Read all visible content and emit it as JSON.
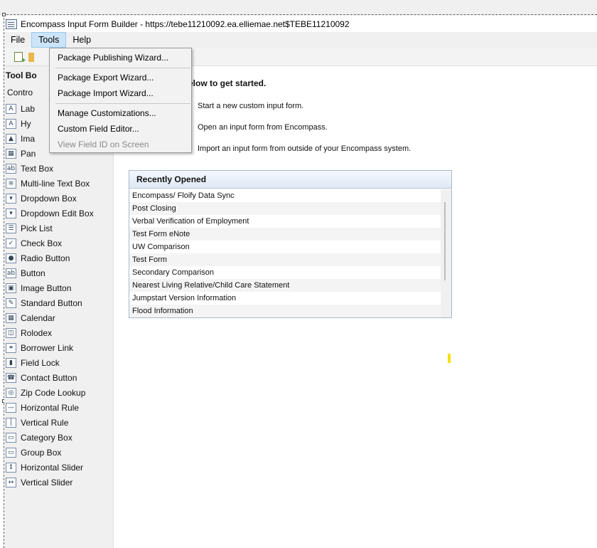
{
  "window": {
    "title": "Encompass Input Form Builder - https://tebe11210092.ea.elliemae.net$TEBE11210092"
  },
  "menubar": {
    "items": [
      "File",
      "Tools",
      "Help"
    ]
  },
  "tools_menu": {
    "items": [
      {
        "label": "Package Publishing Wizard...",
        "enabled": true
      },
      {
        "label": "Package Export Wizard...",
        "enabled": true
      },
      {
        "label": "Package Import Wizard...",
        "enabled": true
      },
      {
        "label": "Manage Customizations...",
        "enabled": true
      },
      {
        "label": "Custom Field Editor...",
        "enabled": true
      },
      {
        "label": "View Field ID on Screen",
        "enabled": false
      }
    ]
  },
  "toolbox": {
    "header": "Tool Bo",
    "controls_label": "Contro",
    "items": [
      {
        "label": "Lab",
        "icon": "label-icon"
      },
      {
        "label": "Hy",
        "icon": "hyperlink-icon"
      },
      {
        "label": "Ima",
        "icon": "image-icon"
      },
      {
        "label": "Pan",
        "icon": "panel-icon"
      },
      {
        "label": "Text Box",
        "icon": "textbox-icon"
      },
      {
        "label": "Multi-line Text Box",
        "icon": "multiline-textbox-icon"
      },
      {
        "label": "Dropdown Box",
        "icon": "dropdown-icon"
      },
      {
        "label": "Dropdown Edit Box",
        "icon": "dropdown-edit-icon"
      },
      {
        "label": "Pick List",
        "icon": "picklist-icon"
      },
      {
        "label": "Check Box",
        "icon": "checkbox-icon"
      },
      {
        "label": "Radio Button",
        "icon": "radio-icon"
      },
      {
        "label": "Button",
        "icon": "button-icon"
      },
      {
        "label": "Image Button",
        "icon": "image-button-icon"
      },
      {
        "label": "Standard Button",
        "icon": "standard-button-icon"
      },
      {
        "label": "Calendar",
        "icon": "calendar-icon"
      },
      {
        "label": "Rolodex",
        "icon": "rolodex-icon"
      },
      {
        "label": "Borrower Link",
        "icon": "borrower-link-icon"
      },
      {
        "label": "Field Lock",
        "icon": "lock-icon"
      },
      {
        "label": "Contact Button",
        "icon": "contact-icon"
      },
      {
        "label": "Zip Code Lookup",
        "icon": "zip-lookup-icon"
      },
      {
        "label": "Horizontal Rule",
        "icon": "horizontal-rule-icon"
      },
      {
        "label": "Vertical Rule",
        "icon": "vertical-rule-icon"
      },
      {
        "label": "Category Box",
        "icon": "category-box-icon"
      },
      {
        "label": "Group Box",
        "icon": "group-box-icon"
      },
      {
        "label": "Horizontal Slider",
        "icon": "horizontal-slider-icon"
      },
      {
        "label": "Vertical Slider",
        "icon": "vertical-slider-icon"
      }
    ]
  },
  "main": {
    "intro": "elow to get started.",
    "actions": [
      "Start a new custom input form.",
      "Open an input form from Encompass.",
      "Import an input form from outside of your Encompass system."
    ],
    "recent": {
      "header": "Recently Opened",
      "items": [
        "Encompass/ Floify Data Sync",
        "Post Closing",
        "Verbal Verification of Employment",
        "Test Form eNote",
        "UW Comparison",
        "Test Form",
        "Secondary Comparison",
        "Nearest Living Relative/Child Care Statement",
        "Jumpstart Version Information",
        "Flood Information"
      ]
    }
  }
}
